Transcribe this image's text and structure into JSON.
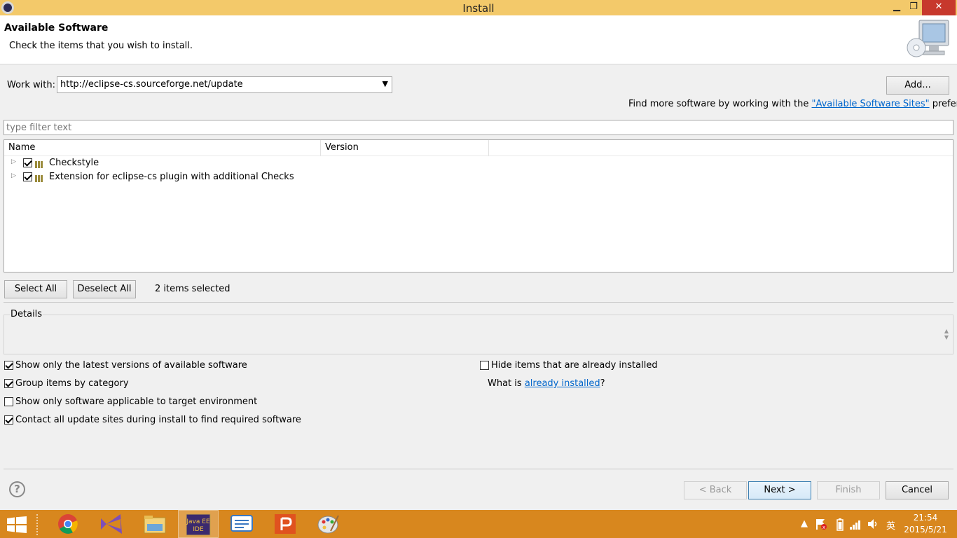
{
  "window": {
    "title": "Install",
    "minimize": "▁",
    "maximize": "❐",
    "close": "✕"
  },
  "header": {
    "title": "Available Software",
    "description": "Check the items that you wish to install."
  },
  "work_with": {
    "label": "Work with:",
    "value": "http://eclipse-cs.sourceforge.net/update",
    "add_button": "Add...",
    "find_more_prefix": "Find more software by working with the ",
    "find_more_link": "\"Available Software Sites\"",
    "find_more_suffix": " preferences."
  },
  "filter": {
    "placeholder": "type filter text"
  },
  "table": {
    "columns": [
      "Name",
      "Version"
    ],
    "rows": [
      {
        "name": "Checkstyle",
        "checked": true
      },
      {
        "name": "Extension for eclipse-cs plugin with additional Checks",
        "checked": true
      }
    ]
  },
  "selection": {
    "select_all": "Select All",
    "deselect_all": "Deselect All",
    "status": "2 items selected"
  },
  "details": {
    "title": "Details"
  },
  "options": {
    "latest_versions": {
      "label": "Show only the latest versions of available software",
      "checked": true
    },
    "group_by_category": {
      "label": "Group items by category",
      "checked": true
    },
    "target_env": {
      "label": "Show only software applicable to target environment",
      "checked": false
    },
    "contact_sites": {
      "label": "Contact all update sites during install to find required software",
      "checked": true
    },
    "hide_installed": {
      "label": "Hide items that are already installed",
      "checked": false
    },
    "what_is_prefix": "What is ",
    "what_is_link": "already installed",
    "what_is_suffix": "?"
  },
  "footer": {
    "help": "?",
    "back": "< Back",
    "next": "Next >",
    "finish": "Finish",
    "cancel": "Cancel"
  },
  "taskbar": {
    "items": [
      "windows-start",
      "chrome",
      "visual-studio",
      "file-explorer",
      "eclipse-java-ee",
      "messenger",
      "wps-presentation",
      "paint"
    ],
    "eclipse_label": "Java EE IDE",
    "ime": "英",
    "time": "21:54",
    "date": "2015/5/21"
  }
}
